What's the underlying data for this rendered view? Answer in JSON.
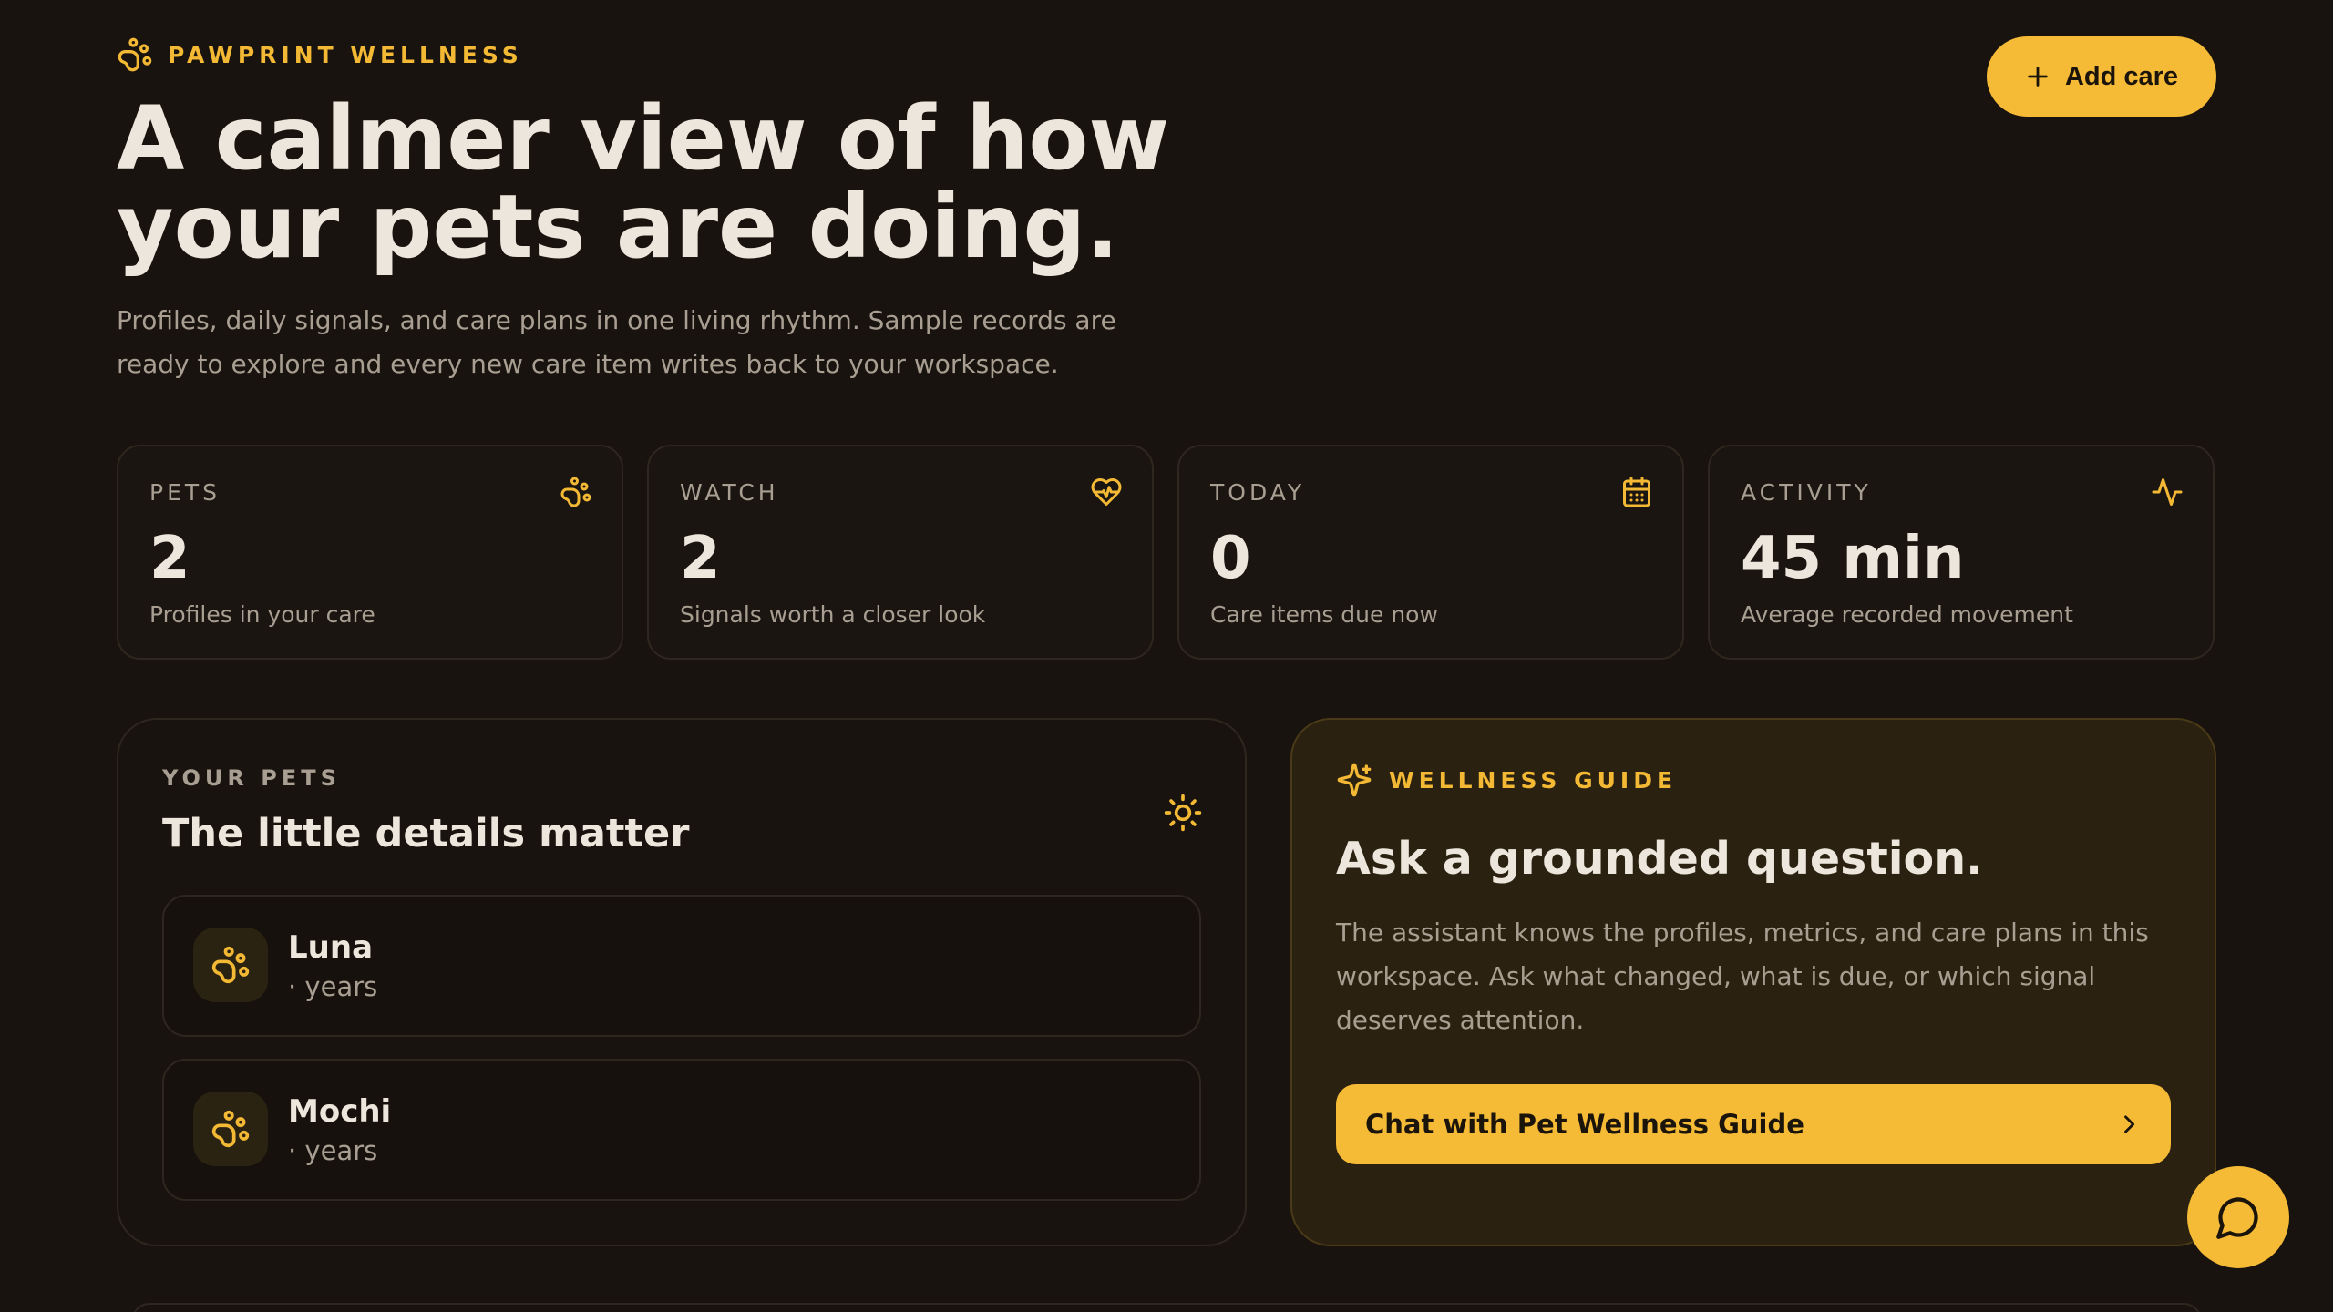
{
  "brand": {
    "name": "PAWPRINT WELLNESS",
    "icon": "paw-icon"
  },
  "header": {
    "add_care_label": "Add care"
  },
  "hero": {
    "title": "A calmer view of how your pets are doing.",
    "subtitle": "Profiles, daily signals, and care plans in one living rhythm. Sample records are ready to explore and every new care item writes back to your workspace."
  },
  "stats": [
    {
      "label": "PETS",
      "value": "2",
      "description": "Profiles in your care",
      "icon": "paw-icon"
    },
    {
      "label": "WATCH",
      "value": "2",
      "description": "Signals worth a closer look",
      "icon": "heart-pulse-icon"
    },
    {
      "label": "TODAY",
      "value": "0",
      "description": "Care items due now",
      "icon": "calendar-icon"
    },
    {
      "label": "ACTIVITY",
      "value": "45 min",
      "description": "Average recorded movement",
      "icon": "activity-icon"
    }
  ],
  "pets_panel": {
    "eyebrow": "YOUR PETS",
    "title": "The little details matter",
    "pets": [
      {
        "name": "Luna",
        "age": "· years"
      },
      {
        "name": "Mochi",
        "age": "· years"
      }
    ]
  },
  "guide": {
    "eyebrow": "WELLNESS GUIDE",
    "title": "Ask a grounded question.",
    "body": "The assistant knows the profiles, metrics, and care plans in this workspace. Ask what changed, what is due, or which signal deserves attention.",
    "cta_label": "Chat with Pet Wellness Guide"
  },
  "colors": {
    "background": "#18130e",
    "accent": "#f5bb36",
    "text": "#ece6dc",
    "muted": "#a89e92"
  }
}
